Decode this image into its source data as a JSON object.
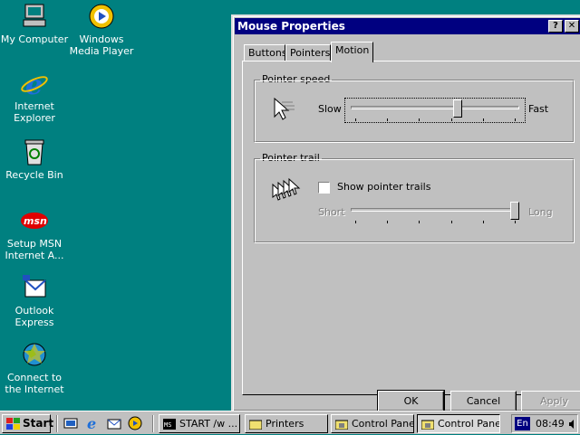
{
  "desktop": {
    "icons": [
      {
        "label": "My Computer"
      },
      {
        "label": "Windows Media Player"
      },
      {
        "label": "Internet Explorer"
      },
      {
        "label": "Recycle Bin"
      },
      {
        "label": "Setup MSN Internet A..."
      },
      {
        "label": "Outlook Express"
      },
      {
        "label": "Connect to the Internet"
      }
    ],
    "msn_logo_text": "msn"
  },
  "window": {
    "title": "Mouse Properties",
    "help_label": "?",
    "close_label": "✕",
    "tabs": [
      {
        "label": "Buttons"
      },
      {
        "label": "Pointers"
      },
      {
        "label": "Motion"
      }
    ],
    "active_tab": "Motion",
    "pointer_speed": {
      "legend": "Pointer speed",
      "slow_label": "Slow",
      "fast_label": "Fast",
      "value_fraction": 0.64
    },
    "pointer_trail": {
      "legend": "Pointer trail",
      "checkbox_label": "Show pointer trails",
      "checked": false,
      "short_label": "Short",
      "long_label": "Long",
      "value_fraction": 1.0,
      "disabled": true
    },
    "buttons": {
      "ok": "OK",
      "cancel": "Cancel",
      "apply": "Apply"
    }
  },
  "taskbar": {
    "start_label": "Start",
    "tasks": [
      {
        "label": "START /w ..."
      },
      {
        "label": "Printers"
      },
      {
        "label": "Control Panel"
      },
      {
        "label": "Control Panel"
      }
    ],
    "language": "En",
    "clock": "08:49"
  },
  "colors": {
    "desktop": "#008080",
    "titlebar": "#000080",
    "face": "#c0c0c0"
  }
}
